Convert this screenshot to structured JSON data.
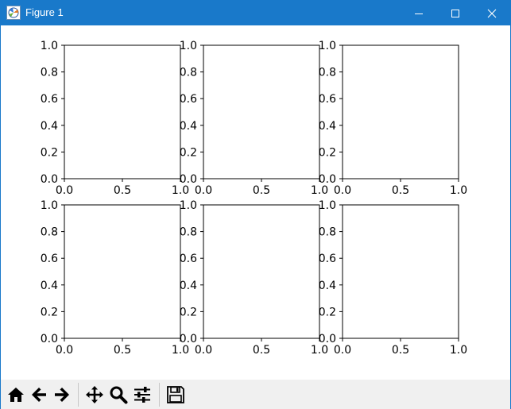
{
  "window": {
    "title": "Figure 1",
    "icons": {
      "app": "matplotlib-figure-icon",
      "minimize": "minimize-icon",
      "maximize": "maximize-icon",
      "close": "close-icon"
    }
  },
  "toolbar": {
    "tools": [
      {
        "name": "home-button",
        "icon": "home-icon"
      },
      {
        "name": "back-button",
        "icon": "arrow-left-icon"
      },
      {
        "name": "forward-button",
        "icon": "arrow-right-icon"
      },
      {
        "name": "pan-button",
        "icon": "move-icon"
      },
      {
        "name": "zoom-button",
        "icon": "magnifier-icon"
      },
      {
        "name": "configure-subplots-button",
        "icon": "sliders-icon"
      },
      {
        "name": "save-button",
        "icon": "floppy-disk-icon"
      }
    ]
  },
  "chart_data": [
    {
      "type": "scatter",
      "series": [],
      "xlim": [
        0,
        1
      ],
      "ylim": [
        0,
        1
      ],
      "xticks": [
        "0.0",
        "0.5",
        "1.0"
      ],
      "yticks": [
        "0.0",
        "0.2",
        "0.4",
        "0.6",
        "0.8",
        "1.0"
      ],
      "grid": false
    },
    {
      "type": "scatter",
      "series": [],
      "xlim": [
        0,
        1
      ],
      "ylim": [
        0,
        1
      ],
      "xticks": [
        "0.0",
        "0.5",
        "1.0"
      ],
      "yticks": [
        "0.0",
        "0.2",
        "0.4",
        "0.6",
        "0.8",
        "1.0"
      ],
      "grid": false
    },
    {
      "type": "scatter",
      "series": [],
      "xlim": [
        0,
        1
      ],
      "ylim": [
        0,
        1
      ],
      "xticks": [
        "0.0",
        "0.5",
        "1.0"
      ],
      "yticks": [
        "0.0",
        "0.2",
        "0.4",
        "0.6",
        "0.8",
        "1.0"
      ],
      "grid": false
    },
    {
      "type": "scatter",
      "series": [],
      "xlim": [
        0,
        1
      ],
      "ylim": [
        0,
        1
      ],
      "xticks": [
        "0.0",
        "0.5",
        "1.0"
      ],
      "yticks": [
        "0.0",
        "0.2",
        "0.4",
        "0.6",
        "0.8",
        "1.0"
      ],
      "grid": false
    },
    {
      "type": "scatter",
      "series": [],
      "xlim": [
        0,
        1
      ],
      "ylim": [
        0,
        1
      ],
      "xticks": [
        "0.0",
        "0.5",
        "1.0"
      ],
      "yticks": [
        "0.0",
        "0.2",
        "0.4",
        "0.6",
        "0.8",
        "1.0"
      ],
      "grid": false
    },
    {
      "type": "scatter",
      "series": [],
      "xlim": [
        0,
        1
      ],
      "ylim": [
        0,
        1
      ],
      "xticks": [
        "0.0",
        "0.5",
        "1.0"
      ],
      "yticks": [
        "0.0",
        "0.2",
        "0.4",
        "0.6",
        "0.8",
        "1.0"
      ],
      "grid": false
    }
  ]
}
